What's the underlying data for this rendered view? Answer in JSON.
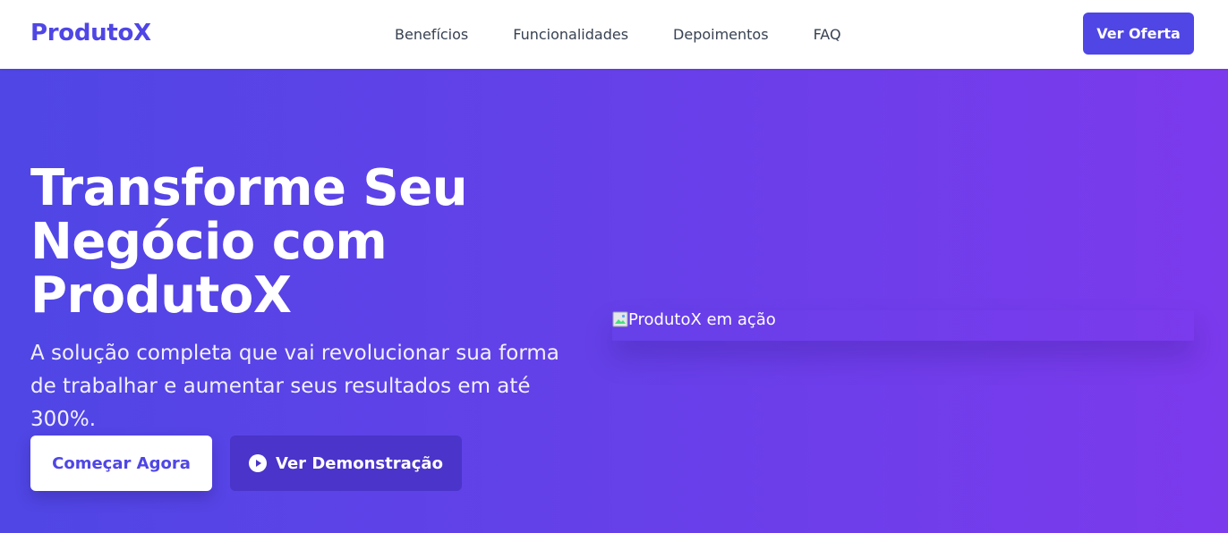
{
  "nav": {
    "logo": "ProdutoX",
    "links": [
      "Benefícios",
      "Funcionalidades",
      "Depoimentos",
      "FAQ"
    ],
    "cta": "Ver Oferta"
  },
  "hero": {
    "title": "Transforme Seu Negócio com ProdutoX",
    "subtitle": "A solução completa que vai revolucionar sua forma de trabalhar e aumentar seus resultados em até 300%.",
    "primary_button": "Começar Agora",
    "secondary_button": "Ver Demonstração",
    "secondary_icon": "play-circle-icon",
    "image_alt": "ProdutoX em ação"
  },
  "colors": {
    "brand": "#4f46e5",
    "gradient_start": "#4f46e5",
    "gradient_end": "#7c3aed",
    "secondary_button_bg": "#4a34c9"
  }
}
